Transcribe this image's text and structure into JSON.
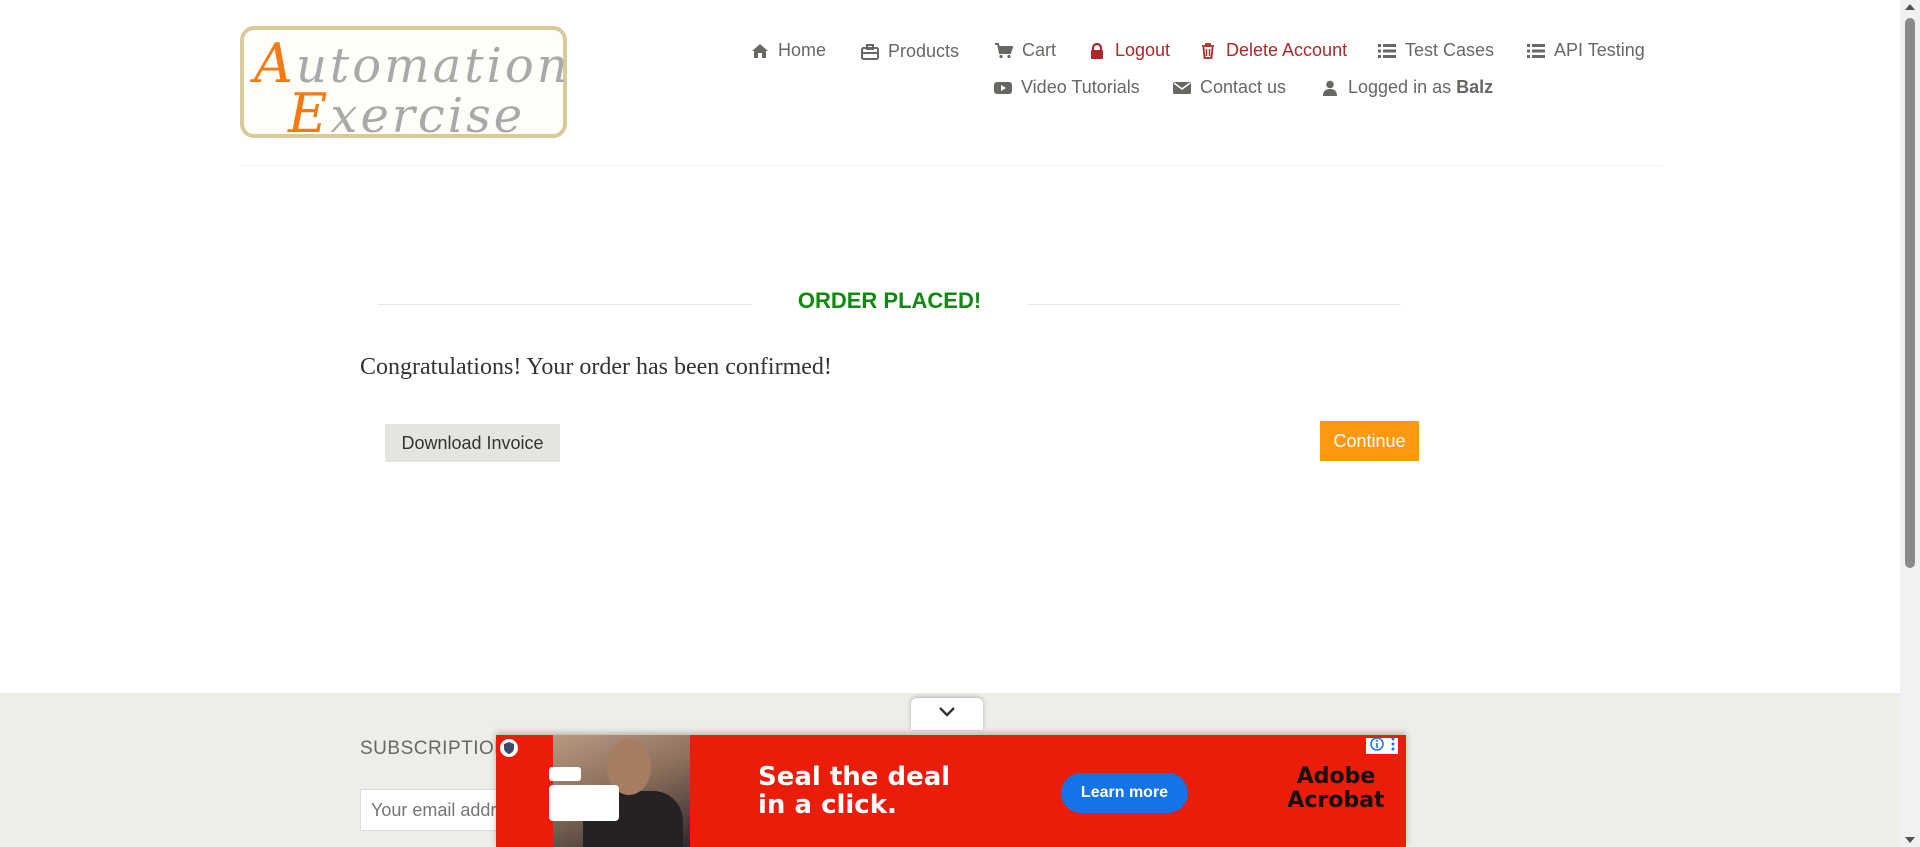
{
  "logo": {
    "line1_cap": "A",
    "line1_rest": "utomation",
    "line2_cap": "E",
    "line2_rest": "xercise"
  },
  "nav": {
    "home": "Home",
    "products": "Products",
    "cart": "Cart",
    "logout": "Logout",
    "delete_account": "Delete Account",
    "test_cases": "Test Cases",
    "api_testing": "API Testing",
    "video_tutorials": "Video Tutorials",
    "contact_us": "Contact us",
    "logged_in_prefix": "Logged in as",
    "username": "Balz"
  },
  "main": {
    "title": "ORDER PLACED!",
    "message": "Congratulations! Your order has been confirmed!",
    "download_button": "Download Invoice",
    "continue_button": "Continue"
  },
  "footer": {
    "subscription_title": "SUBSCRIPTION",
    "email_placeholder": "Your email address"
  },
  "ad": {
    "headline": "Seal the deal in a click.",
    "cta": "Learn more",
    "brand": "Adobe Acrobat"
  },
  "colors": {
    "accent": "#fe980f",
    "success": "#0f8a0f",
    "danger": "#b0262a",
    "ad_red": "#ec1c0a",
    "ad_blue": "#1473e6"
  }
}
